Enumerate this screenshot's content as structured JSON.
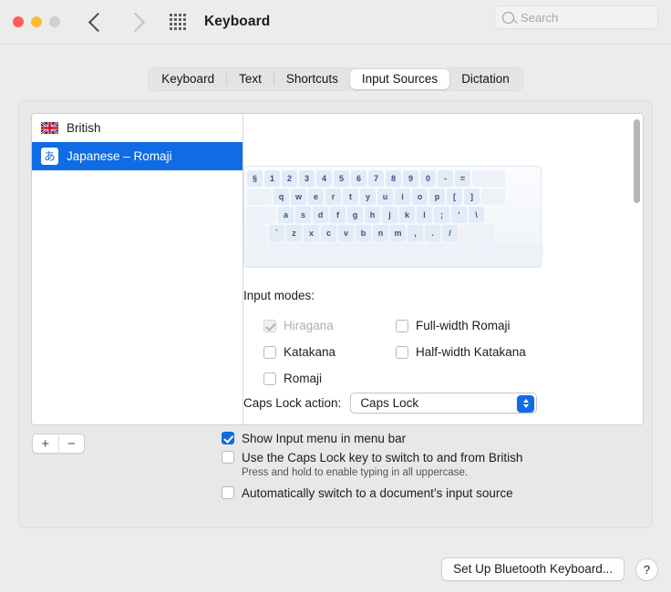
{
  "window": {
    "title": "Keyboard",
    "traffic_lights": [
      "close",
      "minimize",
      "zoom"
    ],
    "back_icon": "chevron-left-icon",
    "forward_icon": "chevron-right-icon",
    "grid_icon": "show-all-grid-icon"
  },
  "search": {
    "placeholder": "Search",
    "value": "",
    "icon": "search-icon"
  },
  "tabs": [
    {
      "label": "Keyboard",
      "selected": false
    },
    {
      "label": "Text",
      "selected": false
    },
    {
      "label": "Shortcuts",
      "selected": false
    },
    {
      "label": "Input Sources",
      "selected": true
    },
    {
      "label": "Dictation",
      "selected": false
    }
  ],
  "input_sources": [
    {
      "label": "British",
      "icon": "union-jack-flag-icon",
      "selected": false
    },
    {
      "label": "Japanese – Romaji",
      "icon": "japanese-hiragana-a-icon",
      "glyph": "あ",
      "selected": true
    }
  ],
  "list_controls": {
    "add_label": "+",
    "remove_label": "−"
  },
  "keyboard_preview": {
    "rows": [
      {
        "keys": [
          "§",
          "1",
          "2",
          "3",
          "4",
          "5",
          "6",
          "7",
          "8",
          "9",
          "0",
          "-",
          "="
        ],
        "lead": 0,
        "trail_blanks": 1
      },
      {
        "keys": [
          "q",
          "w",
          "e",
          "r",
          "t",
          "y",
          "u",
          "i",
          "o",
          "p",
          "[",
          "]"
        ],
        "lead": 1,
        "trail_blanks": 1
      },
      {
        "keys": [
          "a",
          "s",
          "d",
          "f",
          "g",
          "h",
          "j",
          "k",
          "l",
          ";",
          "'",
          "\\"
        ],
        "lead": 1,
        "trail_blanks": 0
      },
      {
        "keys": [
          "`",
          "z",
          "x",
          "c",
          "v",
          "b",
          "n",
          "m",
          ",",
          ".",
          "/"
        ],
        "lead": 1,
        "trail_blanks": 1
      },
      {
        "keys": [],
        "lead": 0,
        "trail_blanks": 0
      }
    ]
  },
  "input_modes": {
    "label": "Input modes:",
    "items": [
      {
        "label": "Hiragana",
        "checked": true,
        "disabled": true,
        "col": 1
      },
      {
        "label": "Full-width Romaji",
        "checked": false,
        "disabled": false,
        "col": 2
      },
      {
        "label": "Katakana",
        "checked": false,
        "disabled": false,
        "col": 1
      },
      {
        "label": "Half-width Katakana",
        "checked": false,
        "disabled": false,
        "col": 2
      },
      {
        "label": "Romaji",
        "checked": false,
        "disabled": false,
        "col": 1
      }
    ]
  },
  "caps_lock": {
    "label": "Caps Lock action:",
    "value": "Caps Lock",
    "options": [
      "Caps Lock"
    ],
    "arrows_icon": "chevron-up-down-icon"
  },
  "bottom_options": [
    {
      "label": "Show Input menu in menu bar",
      "checked": true,
      "hint": ""
    },
    {
      "label": "Use the Caps Lock key to switch to and from British",
      "checked": false,
      "hint": "Press and hold to enable typing in all uppercase."
    },
    {
      "label": "Automatically switch to a document’s input source",
      "checked": false,
      "hint": ""
    }
  ],
  "footer": {
    "bluetooth_button": "Set Up Bluetooth Keyboard...",
    "help_button": "?"
  },
  "colors": {
    "accent": "#0f6ce4",
    "window_bg": "#ececec",
    "panel_bg": "#e8e8e8",
    "selection": "#0f6ce4"
  }
}
